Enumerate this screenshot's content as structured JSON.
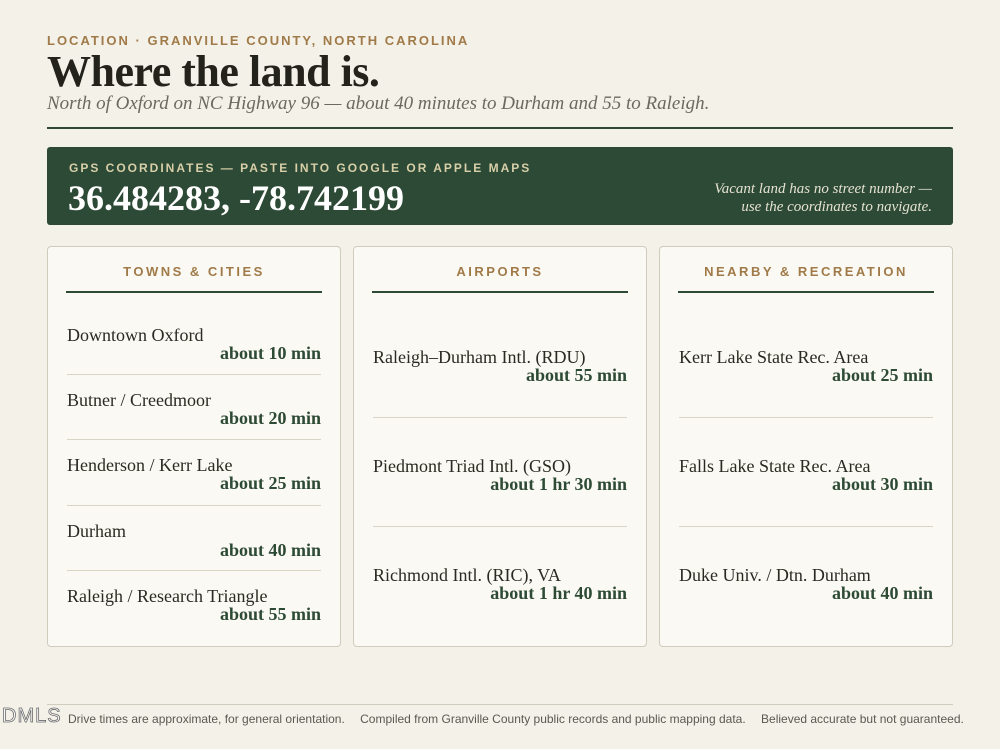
{
  "header": {
    "eyebrow": "LOCATION · GRANVILLE COUNTY, NORTH CAROLINA",
    "title": "Where the land is.",
    "subtitle": "North of Oxford on NC Highway 96 — about 40 minutes to Durham and 55 to Raleigh."
  },
  "gps": {
    "label": "GPS COORDINATES — PASTE INTO GOOGLE OR APPLE MAPS",
    "coordinates": "36.484283, -78.742199",
    "note_line1": "Vacant land has no street number —",
    "note_line2": "use the coordinates to navigate."
  },
  "cards": [
    {
      "title": "TOWNS & CITIES",
      "items": [
        {
          "name": "Downtown Oxford",
          "time": "about 10 min"
        },
        {
          "name": "Butner / Creedmoor",
          "time": "about 20 min"
        },
        {
          "name": "Henderson / Kerr Lake",
          "time": "about 25 min"
        },
        {
          "name": "Durham",
          "time": "about 40 min"
        },
        {
          "name": "Raleigh / Research Triangle",
          "time": "about 55 min"
        }
      ]
    },
    {
      "title": "AIRPORTS",
      "items": [
        {
          "name": "Raleigh–Durham Intl. (RDU)",
          "time": "about 55 min"
        },
        {
          "name": "Piedmont Triad Intl. (GSO)",
          "time": "about 1 hr 30 min"
        },
        {
          "name": "Richmond Intl. (RIC), VA",
          "time": "about 1 hr 40 min"
        }
      ]
    },
    {
      "title": "NEARBY & RECREATION",
      "items": [
        {
          "name": "Kerr Lake State Rec. Area",
          "time": "about 25 min"
        },
        {
          "name": "Falls Lake State Rec. Area",
          "time": "about 30 min"
        },
        {
          "name": "Duke Univ. / Dtn. Durham",
          "time": "about 40 min"
        }
      ]
    }
  ],
  "footer": {
    "logo": "DMLS",
    "note1": "Drive times are approximate, for general orientation.",
    "note2": "Compiled from Granville County public records and public mapping data.",
    "note3": "Believed accurate but not guaranteed."
  }
}
